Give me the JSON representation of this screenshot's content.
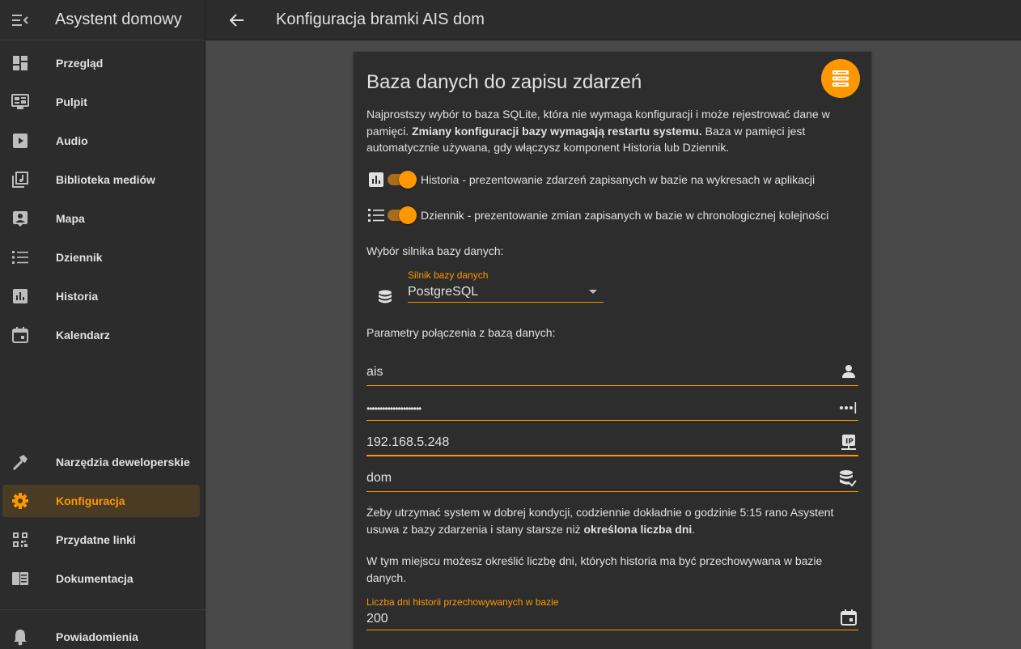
{
  "app": {
    "title": "Asystent domowy"
  },
  "topbar": {
    "title": "Konfiguracja bramki AIS dom"
  },
  "sidebar": {
    "items": [
      {
        "label": "Przegląd",
        "icon": "dashboard-icon"
      },
      {
        "label": "Pulpit",
        "icon": "monitor-dashboard-icon"
      },
      {
        "label": "Audio",
        "icon": "play-box-icon"
      },
      {
        "label": "Biblioteka mediów",
        "icon": "library-music-icon"
      },
      {
        "label": "Mapa",
        "icon": "account-box-icon"
      },
      {
        "label": "Dziennik",
        "icon": "format-list-bulleted-icon"
      },
      {
        "label": "Historia",
        "icon": "chart-box-icon"
      },
      {
        "label": "Kalendarz",
        "icon": "calendar-icon"
      }
    ],
    "bottom_items": [
      {
        "label": "Narzędzia deweloperskie",
        "icon": "hammer-icon"
      },
      {
        "label": "Konfiguracja",
        "icon": "cog-icon",
        "active": true
      },
      {
        "label": "Przydatne linki",
        "icon": "qrcode-icon"
      },
      {
        "label": "Dokumentacja",
        "icon": "book-open-icon"
      }
    ],
    "notifications": {
      "label": "Powiadomienia",
      "icon": "bell-icon"
    }
  },
  "card": {
    "title": "Baza danych do zapisu zdarzeń",
    "badge_icon": "server-icon",
    "intro_part1": "Najprostszy wybór to baza SQLite, która nie wymaga konfiguracji i może rejestrować dane w pamięci. ",
    "intro_bold": "Zmiany konfiguracji bazy wymagają restartu systemu.",
    "intro_part2": " Baza w pamięci jest automatycznie używana, gdy włączysz komponent Historia lub Dziennik.",
    "toggle_history": {
      "label": "Historia - prezentowanie zdarzeń zapisanych w bazie na wykresach w aplikacji",
      "on": true
    },
    "toggle_logbook": {
      "label": "Dziennik - prezentowanie zmian zapisanych w bazie w chronologicznej kolejności",
      "on": true
    },
    "engine_section": "Wybór silnika bazy danych:",
    "engine_select": {
      "label": "Silnik bazy danych",
      "value": "PostgreSQL"
    },
    "connection_section": "Parametry połączenia z bazą danych:",
    "user": "ais",
    "password": "•••••••••••••••••••••",
    "host": "192.168.5.248",
    "database": "dom",
    "purge_part1": "Żeby utrzymać system w dobrej kondycji, codziennie dokładnie o godzinie 5:15 rano Asystent usuwa z bazy zdarzenia i stany starsze niż ",
    "purge_bold": "określona liczba dni",
    "purge_part2": ".",
    "days_info": "W tym miejscu możesz określić liczbę dni, których historia ma być przechowywana w bazie danych.",
    "days_field": {
      "label": "Liczba dni historii przechowywanych w bazie",
      "value": "200"
    }
  },
  "colors": {
    "accent": "#ff9800",
    "sidebar_bg": "#2c2c2c",
    "page_bg": "#484848",
    "card_bg": "#2d2d2d"
  }
}
